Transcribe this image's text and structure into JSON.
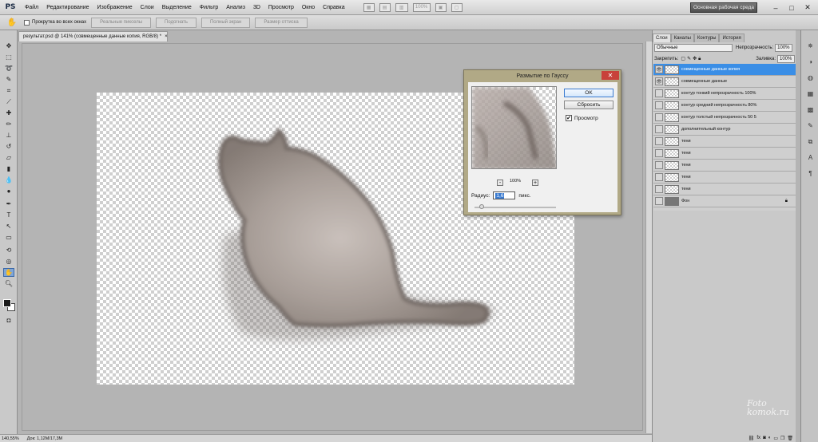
{
  "app": {
    "logo": "PS"
  },
  "menu": [
    "Файл",
    "Редактирование",
    "Изображение",
    "Слои",
    "Выделение",
    "Фильтр",
    "Анализ",
    "3D",
    "Просмотр",
    "Окно",
    "Справка"
  ],
  "menubar": {
    "zoom": "100%",
    "workspace": "Основная рабочая среда",
    "win_min": "–",
    "win_max": "□",
    "win_close": "✕"
  },
  "options": {
    "scroll_all_windows": "Прокрутка во всех окнах",
    "actual_pixels": "Реальные пикселы",
    "fit_screen": "Подогнать",
    "full_screen": "Полный экран",
    "print_size": "Размер оттиска"
  },
  "document": {
    "tab_title": "результат.psd @ 141% (совмещенные данные копия, RGB/8) *",
    "tab_close": "×"
  },
  "status": {
    "zoom": "140,55%",
    "doc_size": "Док: 1,12M/17,3M"
  },
  "panel": {
    "tabs": [
      "Слои",
      "Каналы",
      "Контуры",
      "История"
    ],
    "blend_mode": "Обычные",
    "opacity_label": "Непрозрачность:",
    "opacity_value": "100%",
    "lock_label": "Закрепить:",
    "fill_label": "Заливка:",
    "fill_value": "100%",
    "layers": [
      {
        "name": "совмещенные данные копия",
        "selected": true
      },
      {
        "name": "совмещенные данные",
        "selected": false
      },
      {
        "name": "контур тонкий непрозрачность 100%",
        "selected": false
      },
      {
        "name": "контур средний непрозрачность 80%",
        "selected": false
      },
      {
        "name": "контур толстый непрозрачность 50 5",
        "selected": false
      },
      {
        "name": "дополнительный контур",
        "selected": false
      },
      {
        "name": "тени",
        "selected": false
      },
      {
        "name": "тени",
        "selected": false
      },
      {
        "name": "тени",
        "selected": false
      },
      {
        "name": "тени",
        "selected": false
      },
      {
        "name": "тени",
        "selected": false
      },
      {
        "name": "Фон",
        "selected": false
      }
    ]
  },
  "dialog": {
    "title": "Размытие по Гауссу",
    "close": "✕",
    "ok": "OK",
    "reset": "Сбросить",
    "preview_label": "Просмотр",
    "preview_checked": "✔",
    "zoom_minus": "-",
    "zoom_plus": "+",
    "zoom": "100%",
    "radius_label": "Радиус:",
    "radius_value": "1,6",
    "radius_unit": "пикс."
  },
  "watermark": {
    "line1": "Foto",
    "line2": "komok.ru"
  }
}
